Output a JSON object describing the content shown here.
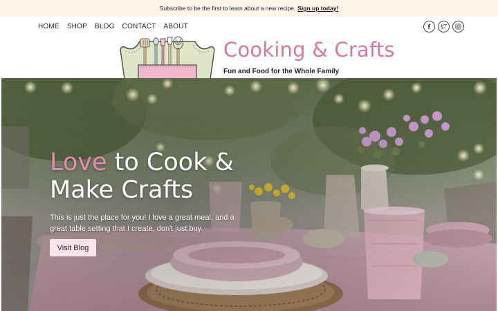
{
  "announcement": {
    "text": "Subscribe to be the first to learn about a new recipe.",
    "link": "Sign up today!"
  },
  "nav": {
    "items": [
      {
        "label": "HOME"
      },
      {
        "label": "SHOP"
      },
      {
        "label": "BLOG"
      },
      {
        "label": "CONTACT"
      },
      {
        "label": "ABOUT"
      }
    ]
  },
  "social": {
    "icons": [
      "facebook-icon",
      "twitter-icon",
      "instagram-icon"
    ]
  },
  "brand": {
    "title": "Cooking & Crafts",
    "tagline": "Fun and Food for the Whole Family",
    "accent": "#d27aa0"
  },
  "hero": {
    "title_highlight": "Love",
    "title_rest_line1": " to Cook &",
    "title_line2": "Make Crafts",
    "text": "This is just the place for you! I love a great meal, and a great table setting that I create, don't just buy.",
    "button": "Visit Blog",
    "highlight_color": "#e48bb0"
  }
}
